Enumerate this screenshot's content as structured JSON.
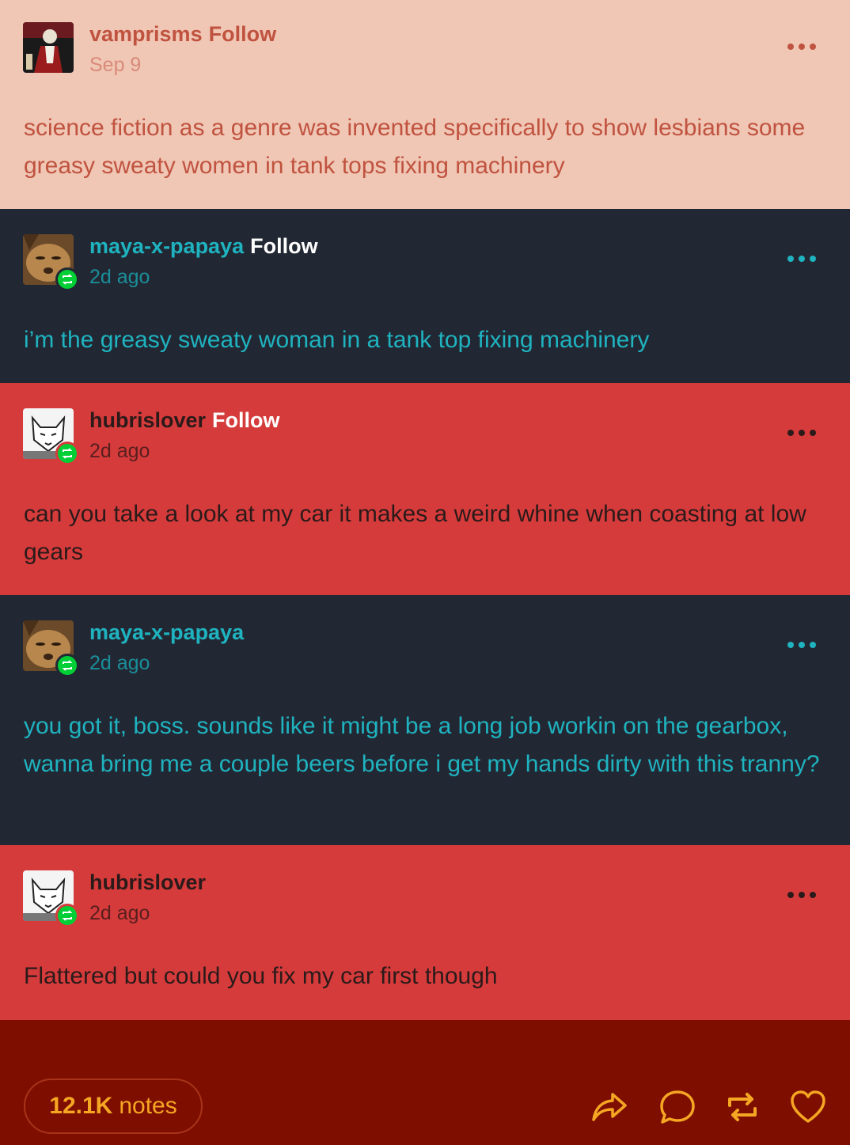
{
  "posts": [
    {
      "username": "vamprisms",
      "follow_label": "Follow",
      "timestamp": "Sep 9",
      "text": "science fiction as a genre was invented specifically to show lesbians some greasy sweaty women in tank tops fixing machinery",
      "reblog_badge": false,
      "colors": {
        "bg": "#f0c6b5",
        "username": "#c0533f",
        "text": "#c0533f"
      }
    },
    {
      "username": "maya-x-papaya",
      "follow_label": "Follow",
      "timestamp": "2d ago",
      "text": "i’m the greasy sweaty woman in a tank top fixing machinery",
      "reblog_badge": true,
      "colors": {
        "bg": "#222833",
        "username": "#1fb3c0",
        "text": "#1fb3c0"
      }
    },
    {
      "username": "hubrislover",
      "follow_label": "Follow",
      "timestamp": "2d ago",
      "text": "can you take a look at my car it makes a weird whine when coasting at low gears",
      "reblog_badge": true,
      "colors": {
        "bg": "#d63b3b",
        "username": "#2b1a1a",
        "text": "#2b1a1a"
      }
    },
    {
      "username": "maya-x-papaya",
      "follow_label": "",
      "timestamp": "2d ago",
      "text": "you got it, boss. sounds like it might be a long job workin on the gearbox, wanna bring me a couple beers before i get my hands dirty with this tranny?",
      "reblog_badge": true,
      "colors": {
        "bg": "#222833",
        "username": "#1fb3c0",
        "text": "#1fb3c0"
      }
    },
    {
      "username": "hubrislover",
      "follow_label": "",
      "timestamp": "2d ago",
      "text": "Flattered but could you fix my car first though",
      "reblog_badge": true,
      "colors": {
        "bg": "#d63b3b",
        "username": "#2b1a1a",
        "text": "#2b1a1a"
      }
    }
  ],
  "footer": {
    "notes_count": "12.1K",
    "notes_label": "notes",
    "actions": [
      "share-icon",
      "reply-icon",
      "reblog-icon",
      "like-icon"
    ],
    "accent": "#f5a623"
  }
}
